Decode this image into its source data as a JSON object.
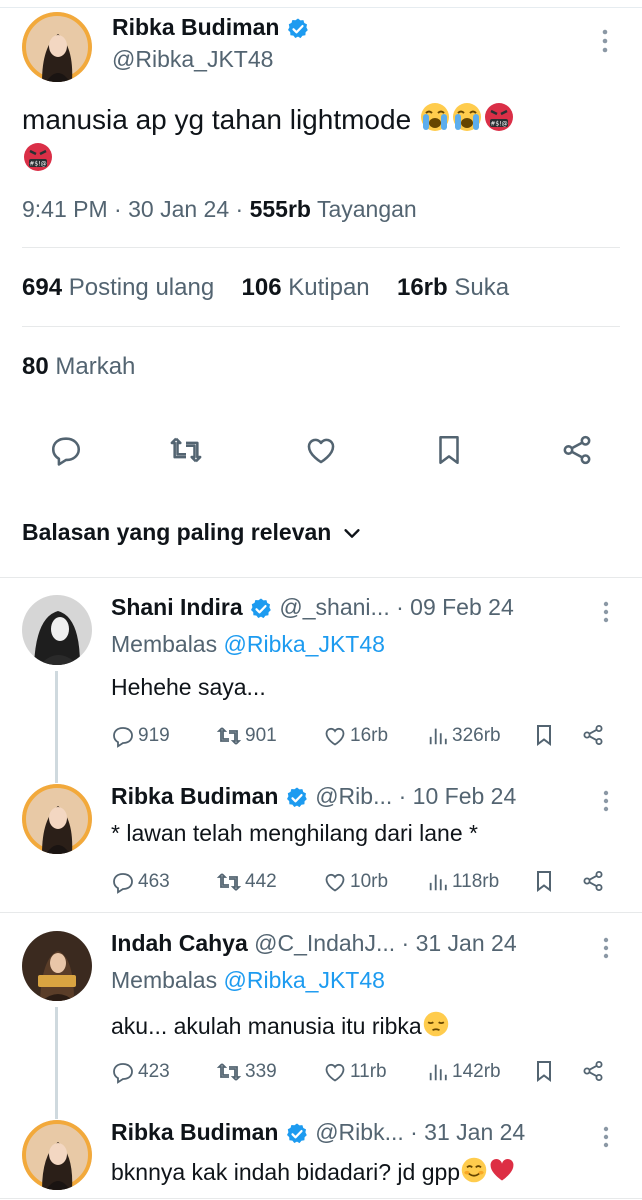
{
  "main_tweet": {
    "author": {
      "name": "Ribka Budiman",
      "handle": "@Ribka_JKT48"
    },
    "text": "manusia ap yg tahan lightmode",
    "emojis": [
      "loudly-crying-face",
      "loudly-crying-face",
      "face-with-symbols",
      "face-with-symbols"
    ],
    "time": "9:41 PM",
    "date": "30 Jan 24",
    "views": "555rb",
    "views_label": "Tayangan",
    "stats": {
      "reposts": "694",
      "reposts_label": "Posting ulang",
      "quotes": "106",
      "quotes_label": "Kutipan",
      "likes": "16rb",
      "likes_label": "Suka",
      "bookmarks": "80",
      "bookmarks_label": "Markah"
    }
  },
  "reply_sort": {
    "label": "Balasan yang paling relevan"
  },
  "replies": [
    {
      "name": "Shani Indira",
      "handle": "@_shani...",
      "date": "· 09 Feb 24",
      "replying_prefix": "Membalas",
      "replying_to": "@Ribka_JKT48",
      "text": "Hehehe saya...",
      "counts": {
        "replies": "919",
        "reposts": "901",
        "likes": "16rb",
        "views": "326rb"
      }
    },
    {
      "name": "Ribka Budiman",
      "handle": "@Rib...",
      "date": "· 10 Feb 24",
      "text": "* lawan telah menghilang dari lane *",
      "counts": {
        "replies": "463",
        "reposts": "442",
        "likes": "10rb",
        "views": "118rb"
      }
    },
    {
      "name": "Indah Cahya",
      "handle": "@C_IndahJ...",
      "date": "· 31 Jan 24",
      "replying_prefix": "Membalas",
      "replying_to": "@Ribka_JKT48",
      "text": "aku... akulah manusia itu ribka",
      "emojis": [
        "pensive-face"
      ],
      "counts": {
        "replies": "423",
        "reposts": "339",
        "likes": "11rb",
        "views": "142rb"
      }
    },
    {
      "name": "Ribka Budiman",
      "handle": "@Ribk...",
      "date": "· 31 Jan 24",
      "text": "bknnya kak indah bidadari? jd gpp",
      "emojis": [
        "smiling-face",
        "red-heart"
      ]
    }
  ],
  "colors": {
    "accent": "#1d9bf0",
    "text": "#0f1419",
    "secondary": "#536471",
    "divider": "#e7e9ea"
  }
}
